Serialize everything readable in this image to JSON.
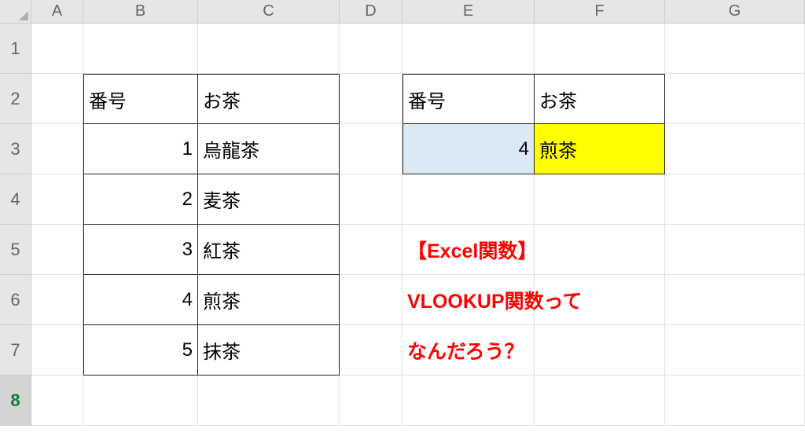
{
  "columns": [
    "A",
    "B",
    "C",
    "D",
    "E",
    "F",
    "G"
  ],
  "rows": [
    "1",
    "2",
    "3",
    "4",
    "5",
    "6",
    "7",
    "8"
  ],
  "active_row_index": 7,
  "table1": {
    "headers": {
      "col1": "番号",
      "col2": "お茶"
    },
    "rows": [
      {
        "num": "1",
        "tea": "烏龍茶"
      },
      {
        "num": "2",
        "tea": "麦茶"
      },
      {
        "num": "3",
        "tea": "紅茶"
      },
      {
        "num": "4",
        "tea": "煎茶"
      },
      {
        "num": "5",
        "tea": "抹茶"
      }
    ]
  },
  "table2": {
    "headers": {
      "col1": "番号",
      "col2": "お茶"
    },
    "lookup_num": "4",
    "lookup_result": "煎茶"
  },
  "annotation": {
    "line1": "【Excel関数】",
    "line2": "VLOOKUP関数って",
    "line3": "なんだろう？"
  },
  "colors": {
    "highlight_blue": "#dbe9f4",
    "highlight_yellow": "#ffff00",
    "text_red": "#ff0000"
  }
}
